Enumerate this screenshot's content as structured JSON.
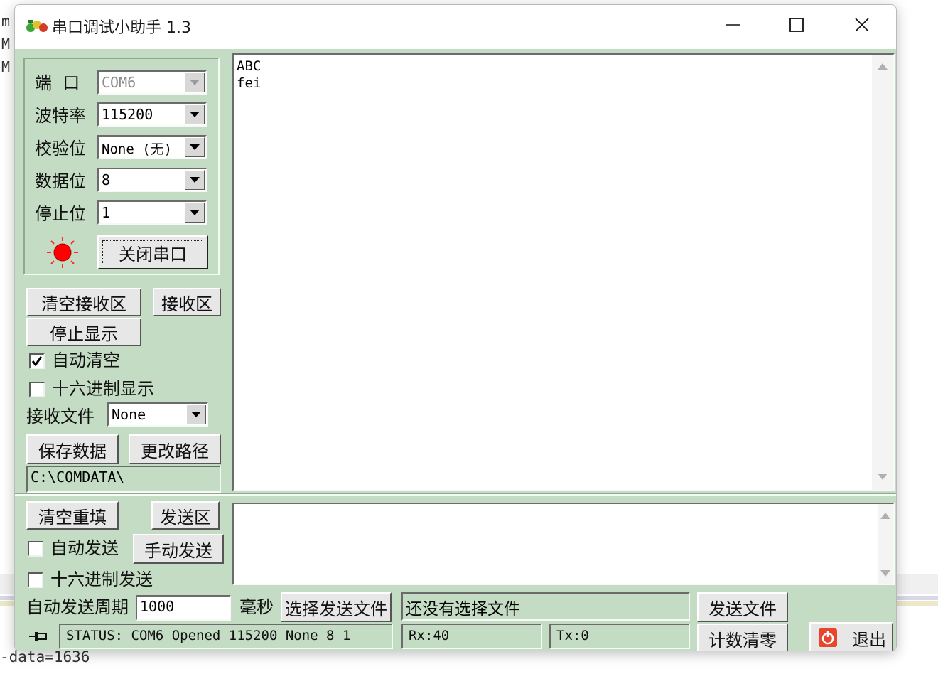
{
  "background": {
    "left_chars": [
      "m",
      "M",
      "M"
    ],
    "bottom_text": "-data=1636"
  },
  "window": {
    "title": "串口调试小助手 1.3",
    "minimize_icon": "minimize-icon",
    "maximize_icon": "maximize-icon",
    "close_icon": "close-icon"
  },
  "settings": {
    "port_label": "端  口",
    "port_value": "COM6",
    "baud_label": "波特率",
    "baud_value": "115200",
    "parity_label": "校验位",
    "parity_value": "None (无)",
    "databits_label": "数据位",
    "databits_value": "8",
    "stopbits_label": "停止位",
    "stopbits_value": "1",
    "indicator_color": "#ff0000",
    "close_port_label": "关闭串口"
  },
  "receive": {
    "clear_label": "清空接收区",
    "area_label": "接收区",
    "stop_display_label": "停止显示",
    "auto_clear_label": "自动清空",
    "auto_clear_checked": true,
    "hex_display_label": "十六进制显示",
    "hex_display_checked": false,
    "file_label": "接收文件",
    "file_value": "None",
    "save_label": "保存数据",
    "change_path_label": "更改路径",
    "path_value": "C:\\COMDATA\\",
    "content": "ABC\nfei"
  },
  "send": {
    "clear_label": "清空重填",
    "area_label": "发送区",
    "auto_send_label": "自动发送",
    "auto_send_checked": false,
    "manual_send_label": "手动发送",
    "hex_send_label": "十六进制发送",
    "hex_send_checked": false,
    "period_label": "自动发送周期",
    "period_value": "1000",
    "ms_label": "毫秒",
    "select_file_label": "选择发送文件",
    "file_status": "还没有选择文件",
    "send_file_label": "发送文件"
  },
  "status": {
    "text": "STATUS: COM6 Opened 115200 None  8 1",
    "rx": "Rx:40",
    "tx": "Tx:0",
    "reset_count_label": "计数清零",
    "exit_label": "退出",
    "exit_icon_color": "#e8452c"
  }
}
